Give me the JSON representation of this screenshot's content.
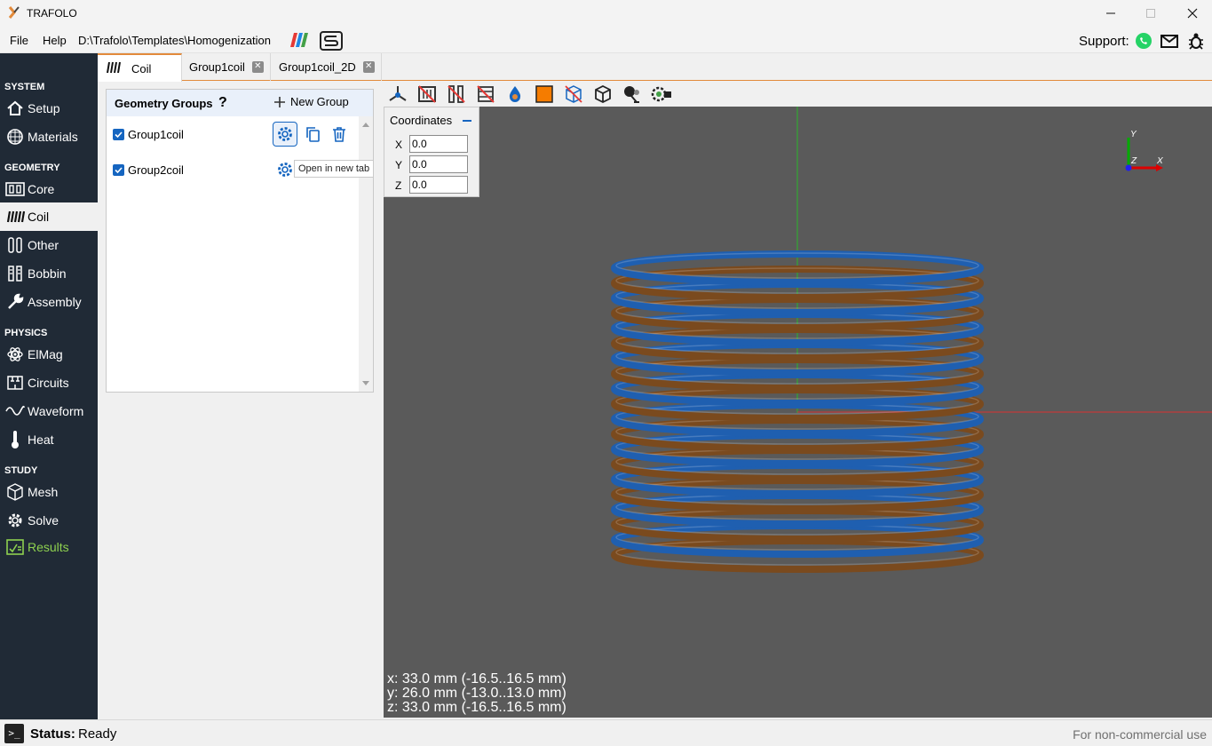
{
  "app": {
    "title": "TRAFOLO"
  },
  "menu": {
    "file": "File",
    "help": "Help",
    "path": "D:\\Trafolo\\Templates\\Homogenization",
    "support_label": "Support:"
  },
  "sidebar": {
    "sections": {
      "system": "SYSTEM",
      "geometry": "GEOMETRY",
      "physics": "PHYSICS",
      "study": "STUDY"
    },
    "items": {
      "setup": "Setup",
      "materials": "Materials",
      "core": "Core",
      "coil": "Coil",
      "other": "Other",
      "bobbin": "Bobbin",
      "assembly": "Assembly",
      "elmag": "ElMag",
      "circuits": "Circuits",
      "waveform": "Waveform",
      "heat": "Heat",
      "mesh": "Mesh",
      "solve": "Solve",
      "results": "Results"
    }
  },
  "tabs": {
    "coil": "Coil",
    "group1coil": "Group1coil",
    "group1coil_2d": "Group1coil_2D"
  },
  "groups": {
    "title": "Geometry Groups",
    "help": "?",
    "new_group": "New Group",
    "rows": [
      {
        "label": "Group1coil",
        "checked": true
      },
      {
        "label": "Group2coil",
        "checked": true
      }
    ],
    "tooltip": "Open in new tab"
  },
  "coordinates": {
    "title": "Coordinates",
    "x_label": "X",
    "y_label": "Y",
    "z_label": "Z",
    "x": "0.0",
    "y": "0.0",
    "z": "0.0"
  },
  "viewport": {
    "axis_y": "Y",
    "axis_z": "Z",
    "axis_x": "X",
    "dim_x": "x: 33.0 mm (-16.5..16.5 mm)",
    "dim_y": "y: 26.0 mm (-13.0..13.0 mm)",
    "dim_z": "z: 33.0 mm (-16.5..16.5 mm)",
    "coil_colors": {
      "blue": "#1f5fb0",
      "brown": "#7a4a1e"
    }
  },
  "status": {
    "label": "Status:",
    "value": "Ready",
    "license": "For non-commercial use"
  },
  "colors": {
    "accent": "#e28a3b",
    "sidebar_bg": "#202a36",
    "link_blue": "#1565c0",
    "results_green": "#8ed14f"
  }
}
